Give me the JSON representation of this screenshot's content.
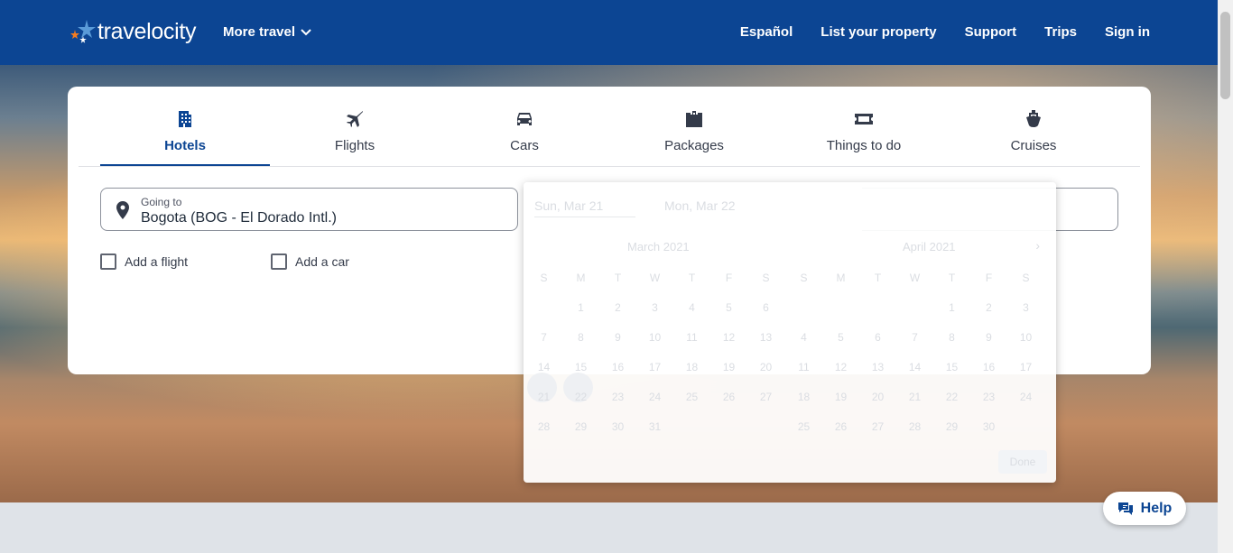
{
  "header": {
    "logo_text": "travelocity",
    "more_travel": "More travel",
    "nav": [
      "Español",
      "List your property",
      "Support",
      "Trips",
      "Sign in"
    ]
  },
  "tabs": [
    {
      "label": "Hotels",
      "icon": "hotel-icon",
      "active": true
    },
    {
      "label": "Flights",
      "icon": "airplane-icon",
      "active": false
    },
    {
      "label": "Cars",
      "icon": "car-icon",
      "active": false
    },
    {
      "label": "Packages",
      "icon": "packages-icon",
      "active": false
    },
    {
      "label": "Things to do",
      "icon": "ticket-icon",
      "active": false
    },
    {
      "label": "Cruises",
      "icon": "cruise-icon",
      "active": false
    }
  ],
  "search": {
    "going_to_label": "Going to",
    "going_to_value": "Bogota (BOG - El Dorado Intl.)",
    "add_flight": "Add a flight",
    "add_car": "Add a car"
  },
  "calendar": {
    "start_date": "Sun, Mar 21",
    "end_date": "Mon, Mar 22",
    "left_month": "March 2021",
    "right_month": "April 2021",
    "done": "Done",
    "weekdays": [
      "S",
      "M",
      "T",
      "W",
      "T",
      "F",
      "S"
    ],
    "left_days": [
      "",
      "1",
      "2",
      "3",
      "4",
      "5",
      "6",
      "7",
      "8",
      "9",
      "10",
      "11",
      "12",
      "13",
      "14",
      "15",
      "16",
      "17",
      "18",
      "19",
      "20",
      "21",
      "22",
      "23",
      "24",
      "25",
      "26",
      "27",
      "28",
      "29",
      "30",
      "31"
    ],
    "right_days": [
      "",
      "",
      "",
      "",
      "1",
      "2",
      "3",
      "4",
      "5",
      "6",
      "7",
      "8",
      "9",
      "10",
      "11",
      "12",
      "13",
      "14",
      "15",
      "16",
      "17",
      "18",
      "19",
      "20",
      "21",
      "22",
      "23",
      "24",
      "25",
      "26",
      "27",
      "28",
      "29",
      "30"
    ]
  },
  "help": {
    "label": "Help",
    "icon": "chat-icon"
  },
  "colors": {
    "brand": "#0c4593",
    "accent": "#f57c20"
  }
}
